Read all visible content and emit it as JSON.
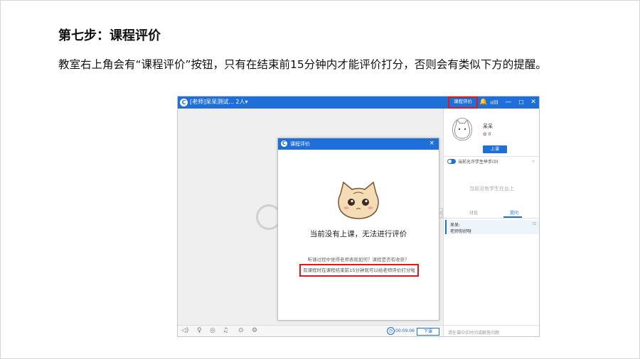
{
  "slide": {
    "title": "第七步：课程评价",
    "description": "教室右上角会有“课程评价”按钮，只有在结束前15分钟内才能评价打分，否则会有类似下方的提醒。"
  },
  "app": {
    "titlebar": {
      "logo_glyph": "C",
      "room_label": "[老师]呆呆测试... 2人▾",
      "eval_button": "课程评价",
      "bell_glyph": "🔔",
      "signal_glyph": "ıılll",
      "minimize_glyph": "—",
      "maximize_glyph": "☐",
      "close_glyph": "✕"
    },
    "dialog": {
      "logo_glyph": "C",
      "title": "课程评价",
      "close_glyph": "×",
      "message": "当前没有上课，无法进行评价",
      "sub_text": "听课过程中觉得老师表现如何？课程是否有收获？",
      "hint": "有课程时在课程结束前15分钟就可以给老师评价打分啦"
    },
    "bottombar": {
      "icons": [
        "speaker-icon",
        "mic-icon",
        "camera-icon",
        "music-icon",
        "record-icon",
        "settings-icon"
      ],
      "icon_glyphs": [
        "◁)",
        "♀",
        "◎",
        "♫",
        "⊙",
        "⚙"
      ],
      "timer_glyph": "◷",
      "elapsed_time": "00:09:06",
      "exit_button": "下课"
    },
    "sidebar": {
      "teacher_name": "呆呆",
      "flower_glyph": "✿",
      "flower_count": "0",
      "up_button": "上课",
      "allow_raise_hand": "当前允许学生举手(0)",
      "chevron_glyph": "⌄",
      "no_student_text": "当前没有学生在台上",
      "tabs": [
        "讨论",
        "提问"
      ],
      "active_tab": "提问",
      "message_user": "呆呆:",
      "message_text": "老师你好呀",
      "message_icon_glyph": "⊡",
      "input_placeholder": "请在课中实时问或解答问题"
    },
    "colors": {
      "accent": "#1e6fd9",
      "highlight": "#e01818"
    }
  }
}
